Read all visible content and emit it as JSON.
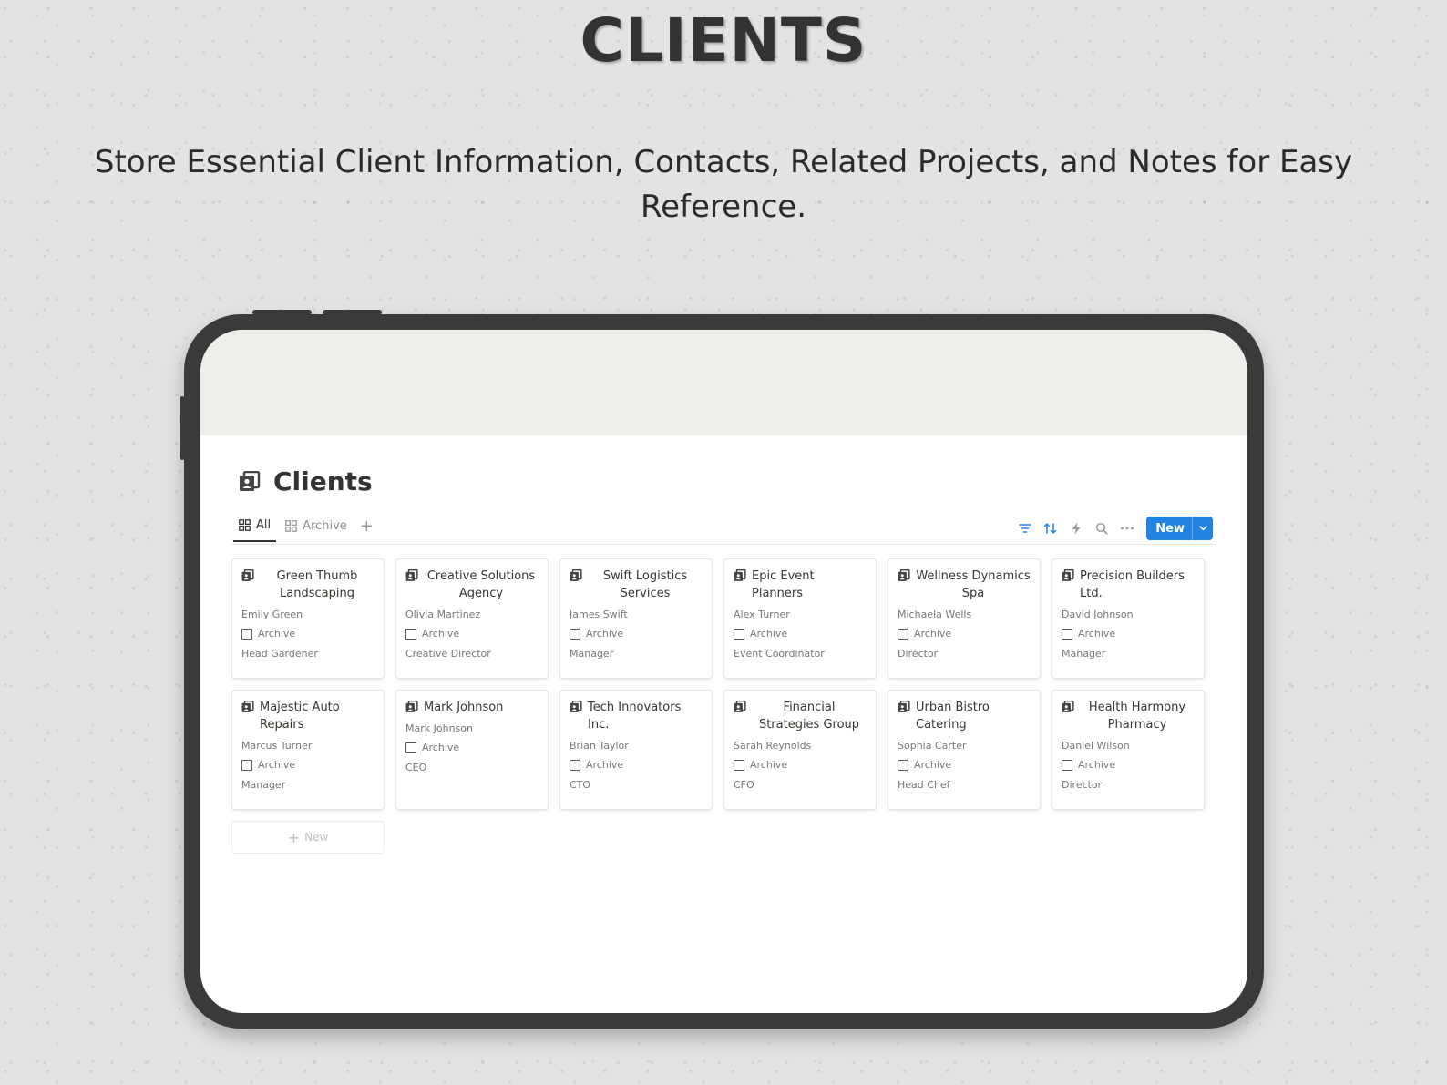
{
  "hero": {
    "title": "CLIENTS",
    "subtitle": "Store Essential Client Information, Contacts, Related Projects, and Notes for Easy Reference."
  },
  "page": {
    "title": "Clients",
    "icon": "client-card-icon"
  },
  "views": {
    "tabs": [
      {
        "label": "All",
        "active": true,
        "icon": "gallery-grid-icon"
      },
      {
        "label": "Archive",
        "active": false,
        "icon": "gallery-grid-icon"
      }
    ],
    "add_icon": "plus-icon"
  },
  "toolbar": {
    "icons": [
      "filter-icon",
      "sort-icon",
      "automation-icon",
      "search-icon",
      "more-icon"
    ],
    "new_label": "New",
    "accent": "#2383e2"
  },
  "cards": [
    {
      "name": "Green Thumb Landscaping",
      "contact": "Emily Green",
      "archive": "Archive",
      "archived": false,
      "role": "Head Gardener"
    },
    {
      "name": "Creative Solutions Agency",
      "contact": "Olivia Martinez",
      "archive": "Archive",
      "archived": false,
      "role": "Creative Director"
    },
    {
      "name": "Swift Logistics Services",
      "contact": "James Swift",
      "archive": "Archive",
      "archived": false,
      "role": "Manager"
    },
    {
      "name": "Epic Event Planners",
      "contact": "Alex Turner",
      "archive": "Archive",
      "archived": false,
      "role": "Event Coordinator"
    },
    {
      "name": "Wellness Dynamics Spa",
      "contact": "Michaela Wells",
      "archive": "Archive",
      "archived": false,
      "role": "Director"
    },
    {
      "name": "Precision Builders Ltd.",
      "contact": "David Johnson",
      "archive": "Archive",
      "archived": false,
      "role": "Manager"
    },
    {
      "name": "Majestic Auto Repairs",
      "contact": "Marcus Turner",
      "archive": "Archive",
      "archived": false,
      "role": "Manager"
    },
    {
      "name": "Mark Johnson",
      "contact": "Mark Johnson",
      "archive": "Archive",
      "archived": false,
      "role": "CEO"
    },
    {
      "name": "Tech Innovators Inc.",
      "contact": "Brian Taylor",
      "archive": "Archive",
      "archived": false,
      "role": "CTO"
    },
    {
      "name": "Financial Strategies Group",
      "contact": "Sarah Reynolds",
      "archive": "Archive",
      "archived": false,
      "role": "CFO"
    },
    {
      "name": "Urban Bistro Catering",
      "contact": "Sophia Carter",
      "archive": "Archive",
      "archived": false,
      "role": "Head Chef"
    },
    {
      "name": "Health Harmony Pharmacy",
      "contact": "Daniel Wilson",
      "archive": "Archive",
      "archived": false,
      "role": "Director"
    }
  ],
  "add_card": {
    "label": "New"
  }
}
